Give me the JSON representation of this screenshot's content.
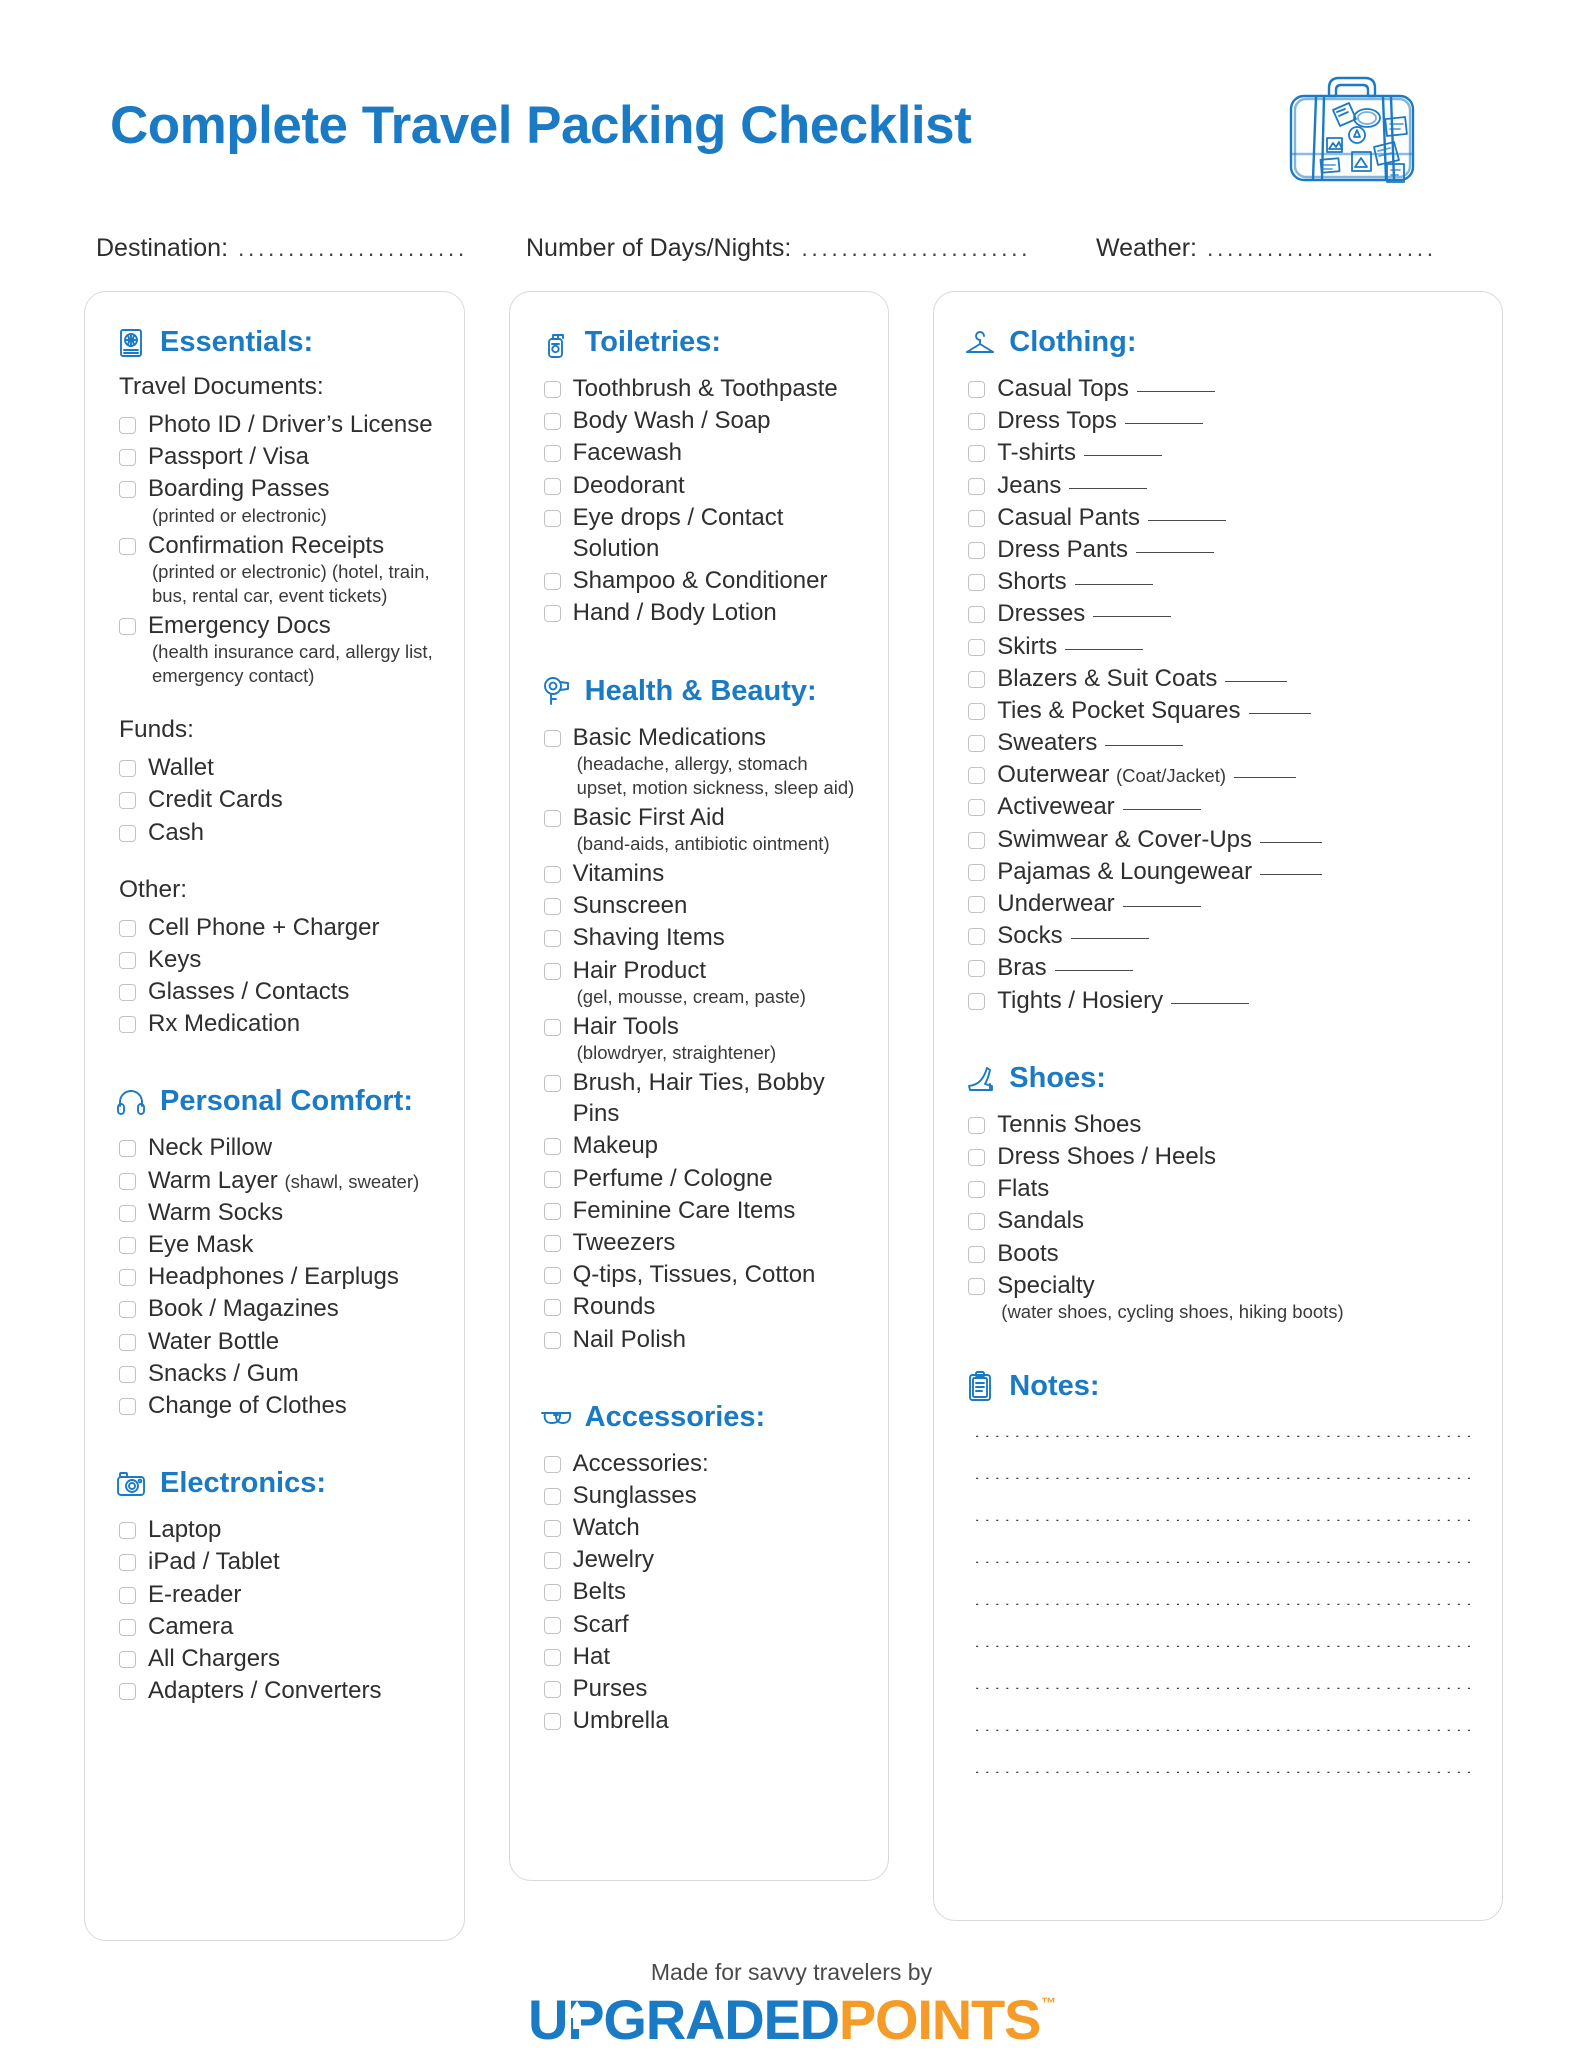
{
  "header": {
    "title": "Complete Travel Packing Checklist",
    "icon": "suitcase-illustration",
    "accent_color": "#1b7ac4",
    "orange_color": "#f59b28"
  },
  "fields": [
    {
      "label": "Destination:",
      "value": "",
      "dots": "............................."
    },
    {
      "label": "Number of Days/Nights:",
      "value": "",
      "dots": "............................."
    },
    {
      "label": "Weather:",
      "value": "",
      "dots": "............................."
    }
  ],
  "columns": [
    {
      "name": "column-left",
      "sections": [
        {
          "title": "Essentials:",
          "icon": "passport-icon",
          "groups": [
            {
              "subhead": "Travel Documents:",
              "items": [
                {
                  "label": "Photo ID / Driver’s License"
                },
                {
                  "label": "Passport / Visa"
                },
                {
                  "label": "Boarding Passes",
                  "note": "(printed or electronic)"
                },
                {
                  "label": "Confirmation Receipts",
                  "note": "(printed or electronic) (hotel, train, bus, rental car, event tickets)"
                },
                {
                  "label": "Emergency Docs",
                  "note": "(health insurance card, allergy list, emergency contact)"
                }
              ]
            },
            {
              "subhead": "Funds:",
              "items": [
                {
                  "label": "Wallet"
                },
                {
                  "label": "Credit Cards"
                },
                {
                  "label": "Cash"
                }
              ]
            },
            {
              "subhead": "Other:",
              "items": [
                {
                  "label": "Cell Phone + Charger"
                },
                {
                  "label": "Keys"
                },
                {
                  "label": "Glasses / Contacts"
                },
                {
                  "label": "Rx Medication"
                }
              ]
            }
          ]
        },
        {
          "title": "Personal Comfort:",
          "icon": "headphones-icon",
          "groups": [
            {
              "subhead": "",
              "items": [
                {
                  "label": "Neck Pillow"
                },
                {
                  "label": "Warm Layer",
                  "inline": "(shawl, sweater)"
                },
                {
                  "label": "Warm Socks"
                },
                {
                  "label": "Eye Mask"
                },
                {
                  "label": "Headphones / Earplugs"
                },
                {
                  "label": "Book / Magazines"
                },
                {
                  "label": "Water Bottle"
                },
                {
                  "label": "Snacks / Gum"
                },
                {
                  "label": "Change of Clothes"
                }
              ]
            }
          ]
        },
        {
          "title": "Electronics:",
          "icon": "camera-icon",
          "groups": [
            {
              "subhead": "",
              "items": [
                {
                  "label": "Laptop"
                },
                {
                  "label": "iPad / Tablet"
                },
                {
                  "label": "E-reader"
                },
                {
                  "label": "Camera"
                },
                {
                  "label": "All Chargers"
                },
                {
                  "label": "Adapters / Converters"
                }
              ]
            }
          ]
        }
      ]
    },
    {
      "name": "column-middle",
      "sections": [
        {
          "title": "Toiletries:",
          "icon": "soap-dispenser-icon",
          "groups": [
            {
              "subhead": "",
              "items": [
                {
                  "label": "Toothbrush & Toothpaste"
                },
                {
                  "label": "Body Wash / Soap"
                },
                {
                  "label": "Facewash"
                },
                {
                  "label": "Deodorant"
                },
                {
                  "label": "Eye drops / Contact Solution"
                },
                {
                  "label": "Shampoo & Conditioner"
                },
                {
                  "label": "Hand / Body Lotion"
                }
              ]
            }
          ]
        },
        {
          "title": "Health & Beauty:",
          "icon": "hairdryer-icon",
          "groups": [
            {
              "subhead": "",
              "items": [
                {
                  "label": "Basic Medications",
                  "note": "(headache, allergy, stomach upset, motion sickness, sleep aid)"
                },
                {
                  "label": "Basic First Aid",
                  "note": "(band-aids, antibiotic ointment)"
                },
                {
                  "label": "Vitamins"
                },
                {
                  "label": "Sunscreen"
                },
                {
                  "label": "Shaving Items"
                },
                {
                  "label": "Hair Product",
                  "note": "(gel, mousse, cream, paste)"
                },
                {
                  "label": "Hair Tools",
                  "note": "(blowdryer, straightener)"
                },
                {
                  "label": "Brush, Hair Ties, Bobby Pins"
                },
                {
                  "label": "Makeup"
                },
                {
                  "label": "Perfume / Cologne"
                },
                {
                  "label": "Feminine Care Items"
                },
                {
                  "label": "Tweezers"
                },
                {
                  "label": "Q-tips, Tissues, Cotton"
                },
                {
                  "label": "Rounds"
                },
                {
                  "label": "Nail Polish"
                }
              ]
            }
          ]
        },
        {
          "title": "Accessories:",
          "icon": "sunglasses-icon",
          "groups": [
            {
              "subhead": "",
              "items": [
                {
                  "label": "Accessories:"
                },
                {
                  "label": "Sunglasses"
                },
                {
                  "label": "Watch"
                },
                {
                  "label": "Jewelry"
                },
                {
                  "label": "Belts"
                },
                {
                  "label": "Scarf"
                },
                {
                  "label": "Hat"
                },
                {
                  "label": "Purses"
                },
                {
                  "label": "Umbrella"
                }
              ]
            }
          ]
        }
      ]
    },
    {
      "name": "column-right",
      "sections": [
        {
          "title": "Clothing:",
          "icon": "hanger-icon",
          "groups": [
            {
              "subhead": "",
              "items": [
                {
                  "label": "Casual Tops",
                  "rule": true
                },
                {
                  "label": "Dress Tops",
                  "rule": true
                },
                {
                  "label": "T-shirts",
                  "rule": true
                },
                {
                  "label": "Jeans",
                  "rule": true
                },
                {
                  "label": "Casual Pants",
                  "rule": true
                },
                {
                  "label": "Dress Pants",
                  "rule": true
                },
                {
                  "label": "Shorts",
                  "rule": true
                },
                {
                  "label": "Dresses",
                  "rule": true
                },
                {
                  "label": "Skirts",
                  "rule": true
                },
                {
                  "label": "Blazers & Suit Coats",
                  "rule": true
                },
                {
                  "label": "Ties & Pocket Squares",
                  "rule": true
                },
                {
                  "label": "Sweaters",
                  "rule": true
                },
                {
                  "label": "Outerwear",
                  "inline": "(Coat/Jacket)",
                  "rule": true
                },
                {
                  "label": "Activewear",
                  "rule": true
                },
                {
                  "label": "Swimwear & Cover-Ups",
                  "rule": true
                },
                {
                  "label": "Pajamas & Loungewear",
                  "rule": true
                },
                {
                  "label": "Underwear",
                  "rule": true
                },
                {
                  "label": "Socks",
                  "rule": true
                },
                {
                  "label": "Bras",
                  "rule": true
                },
                {
                  "label": "Tights / Hosiery",
                  "rule": true
                }
              ]
            }
          ]
        },
        {
          "title": "Shoes:",
          "icon": "high-heel-icon",
          "groups": [
            {
              "subhead": "",
              "items": [
                {
                  "label": "Tennis Shoes"
                },
                {
                  "label": "Dress Shoes / Heels"
                },
                {
                  "label": "Flats"
                },
                {
                  "label": "Sandals"
                },
                {
                  "label": "Boots"
                },
                {
                  "label": "Specialty",
                  "note": "(water shoes, cycling shoes, hiking boots)"
                }
              ]
            }
          ]
        },
        {
          "title": "Notes:",
          "icon": "clipboard-icon",
          "notes_lines": [
            "..................................................",
            "..................................................",
            "..................................................",
            "..................................................",
            "..................................................",
            "..................................................",
            "..................................................",
            "..................................................",
            ".................................................."
          ]
        }
      ]
    }
  ],
  "footer": {
    "made_by": "Made for savvy travelers by",
    "logo_part1": "UPGRADED",
    "logo_part2": "POINTS",
    "trademark": "™"
  }
}
